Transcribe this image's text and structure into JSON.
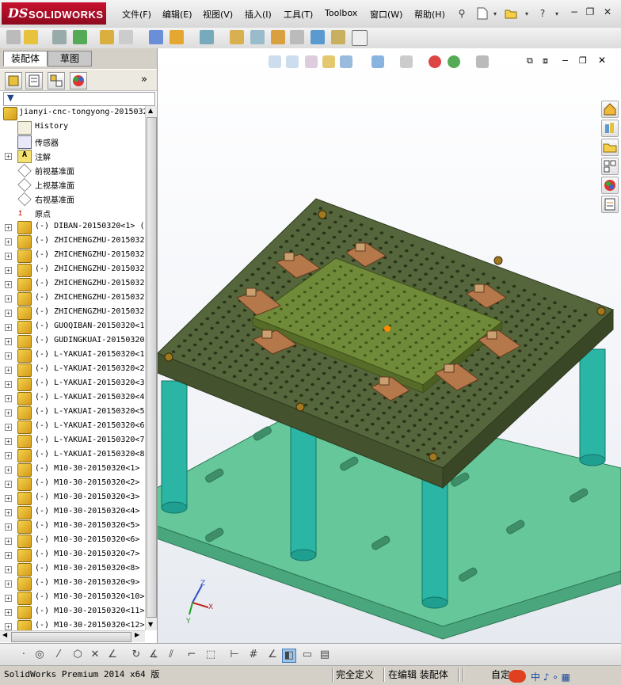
{
  "app": {
    "logo_ds": "DS",
    "logo_name": "SOLIDWORKS"
  },
  "menu": [
    {
      "label": "文件(F)"
    },
    {
      "label": "编辑(E)"
    },
    {
      "label": "视图(V)"
    },
    {
      "label": "插入(I)"
    },
    {
      "label": "工具(T)"
    },
    {
      "label": "Toolbox"
    },
    {
      "label": "窗口(W)"
    },
    {
      "label": "帮助(H)"
    }
  ],
  "left_panel": {
    "tabs": [
      {
        "label": "装配体"
      },
      {
        "label": "草图"
      }
    ],
    "active_tab": "装配体",
    "tree_root": "jianyi-cnc-tongyong-2015032",
    "tree_items": [
      {
        "label": "History",
        "icon": "history-icon",
        "expandable": false
      },
      {
        "label": "传感器",
        "icon": "sensor-icon",
        "expandable": false
      },
      {
        "label": "注解",
        "icon": "annotation-icon",
        "expandable": true
      },
      {
        "label": "前视基准面",
        "icon": "plane-icon",
        "expandable": false
      },
      {
        "label": "上视基准面",
        "icon": "plane-icon",
        "expandable": false
      },
      {
        "label": "右视基准面",
        "icon": "plane-icon",
        "expandable": false
      },
      {
        "label": "原点",
        "icon": "origin-icon",
        "expandable": false
      },
      {
        "label": "(-) DIBAN-20150320<1> (",
        "icon": "component-icon",
        "expandable": true
      },
      {
        "label": "(-) ZHICHENGZHU-2015032",
        "icon": "component-icon",
        "expandable": true
      },
      {
        "label": "(-) ZHICHENGZHU-2015032",
        "icon": "component-icon",
        "expandable": true
      },
      {
        "label": "(-) ZHICHENGZHU-2015032",
        "icon": "component-icon",
        "expandable": true
      },
      {
        "label": "(-) ZHICHENGZHU-2015032",
        "icon": "component-icon",
        "expandable": true
      },
      {
        "label": "(-) ZHICHENGZHU-2015032",
        "icon": "component-icon",
        "expandable": true
      },
      {
        "label": "(-) ZHICHENGZHU-2015032",
        "icon": "component-icon",
        "expandable": true
      },
      {
        "label": "(-) GUOQIBAN-20150320<1",
        "icon": "component-icon",
        "expandable": true
      },
      {
        "label": "(-) GUDINGKUAI-20150320",
        "icon": "component-icon",
        "expandable": true
      },
      {
        "label": "(-) L-YAKUAI-20150320<1",
        "icon": "component-icon",
        "expandable": true
      },
      {
        "label": "(-) L-YAKUAI-20150320<2",
        "icon": "component-icon",
        "expandable": true
      },
      {
        "label": "(-) L-YAKUAI-20150320<3",
        "icon": "component-icon",
        "expandable": true
      },
      {
        "label": "(-) L-YAKUAI-20150320<4",
        "icon": "component-icon",
        "expandable": true
      },
      {
        "label": "(-) L-YAKUAI-20150320<5",
        "icon": "component-icon",
        "expandable": true
      },
      {
        "label": "(-) L-YAKUAI-20150320<6",
        "icon": "component-icon",
        "expandable": true
      },
      {
        "label": "(-) L-YAKUAI-20150320<7",
        "icon": "component-icon",
        "expandable": true
      },
      {
        "label": "(-) L-YAKUAI-20150320<8",
        "icon": "component-icon",
        "expandable": true
      },
      {
        "label": "(-) M10-30-20150320<1>",
        "icon": "component-icon",
        "expandable": true
      },
      {
        "label": "(-) M10-30-20150320<2>",
        "icon": "component-icon",
        "expandable": true
      },
      {
        "label": "(-) M10-30-20150320<3>",
        "icon": "component-icon",
        "expandable": true
      },
      {
        "label": "(-) M10-30-20150320<4>",
        "icon": "component-icon",
        "expandable": true
      },
      {
        "label": "(-) M10-30-20150320<5>",
        "icon": "component-icon",
        "expandable": true
      },
      {
        "label": "(-) M10-30-20150320<6>",
        "icon": "component-icon",
        "expandable": true
      },
      {
        "label": "(-) M10-30-20150320<7>",
        "icon": "component-icon",
        "expandable": true
      },
      {
        "label": "(-) M10-30-20150320<8>",
        "icon": "component-icon",
        "expandable": true
      },
      {
        "label": "(-) M10-30-20150320<9>",
        "icon": "component-icon",
        "expandable": true
      },
      {
        "label": "(-) M10-30-20150320<10>",
        "icon": "component-icon",
        "expandable": true
      },
      {
        "label": "(-) M10-30-20150320<11>",
        "icon": "component-icon",
        "expandable": true
      },
      {
        "label": "(-) M10-30-20150320<12>",
        "icon": "component-icon",
        "expandable": true
      }
    ]
  },
  "triad": {
    "x": "X",
    "y": "Y",
    "z": "Z"
  },
  "status": {
    "product": "SolidWorks Premium 2014 x64 版",
    "definition": "完全定义",
    "editing": "在编辑 装配体",
    "custom": "自定"
  },
  "colors": {
    "top_plate": "#55663c",
    "fixture_plate": "#6f8a38",
    "base_plate": "#66c79a",
    "pillar": "#2ab5a4",
    "clamp": "#b5784a"
  }
}
